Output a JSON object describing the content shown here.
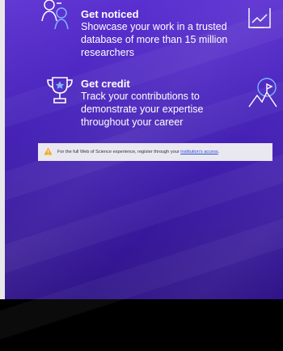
{
  "features": [
    {
      "icon": "people-network-icon",
      "title": "Get noticed",
      "description": "Showcase your work in a trusted database of more than 15 million researchers"
    },
    {
      "icon": "trophy-icon",
      "title": "Get credit",
      "description": "Track your contributions to demonstrate your expertise throughout your career"
    }
  ],
  "right_icons": [
    "document-chart-icon",
    "mountain-flag-icon"
  ],
  "notice": {
    "icon": "warning-icon",
    "text": "For the full Web of Science experience, register through your",
    "link_text": "institution's access",
    "suffix": "."
  },
  "colors": {
    "panel_top": "#5a2fd0",
    "panel_bottom": "#2f1488",
    "warning": "#f5a623",
    "link": "#2a4fd6"
  }
}
